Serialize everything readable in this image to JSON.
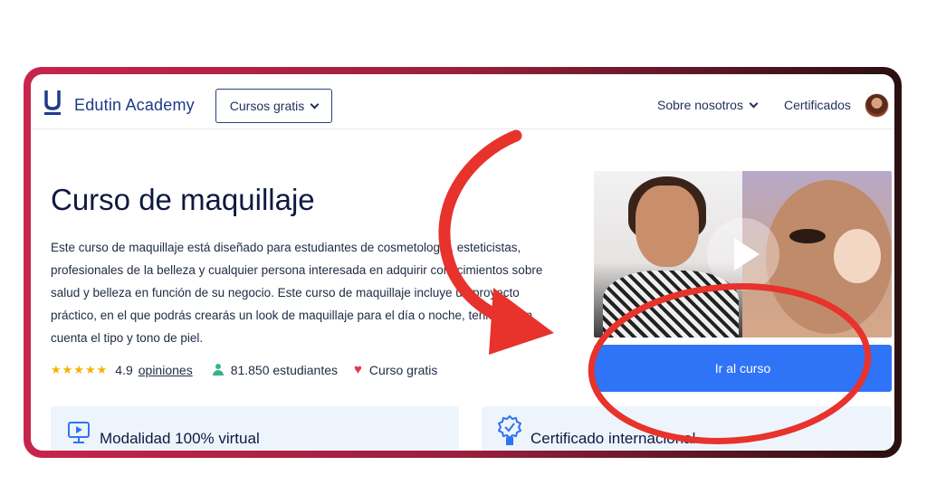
{
  "header": {
    "logo_letter": "U",
    "logo_text": "Edutin Academy",
    "free_courses_label": "Cursos gratis",
    "about_label": "Sobre nosotros",
    "certificates_label": "Certificados"
  },
  "course": {
    "title": "Curso de maquillaje",
    "description": "Este curso de maquillaje está diseñado para estudiantes de cosmetología, esteticistas, profesionales de la belleza y cualquier persona interesada en adquirir conocimientos sobre salud y belleza en función de su negocio. Este curso de maquillaje incluye un proyecto práctico, en el que podrás crearás un look de maquillaje para el día o noche, teniendo en cuenta el tipo y tono de piel.",
    "stars": "★★★★★",
    "rating": "4.9",
    "reviews_label": "opiniones",
    "students": "81.850 estudiantes",
    "free_label": "Curso gratis",
    "cta_label": "Ir al curso"
  },
  "features": [
    {
      "label": "Modalidad 100% virtual",
      "icon": "monitor-icon"
    },
    {
      "label": "Certificado internacional",
      "icon": "certificate-badge-icon"
    }
  ],
  "colors": {
    "brand_navy": "#1e3a8a",
    "cta_blue": "#2f73f6",
    "annotation_red": "#e8322c",
    "frame_crimson": "#c8244b",
    "star_gold": "#f5b301",
    "students_green": "#35b58a",
    "card_bg": "#eef4fb"
  }
}
